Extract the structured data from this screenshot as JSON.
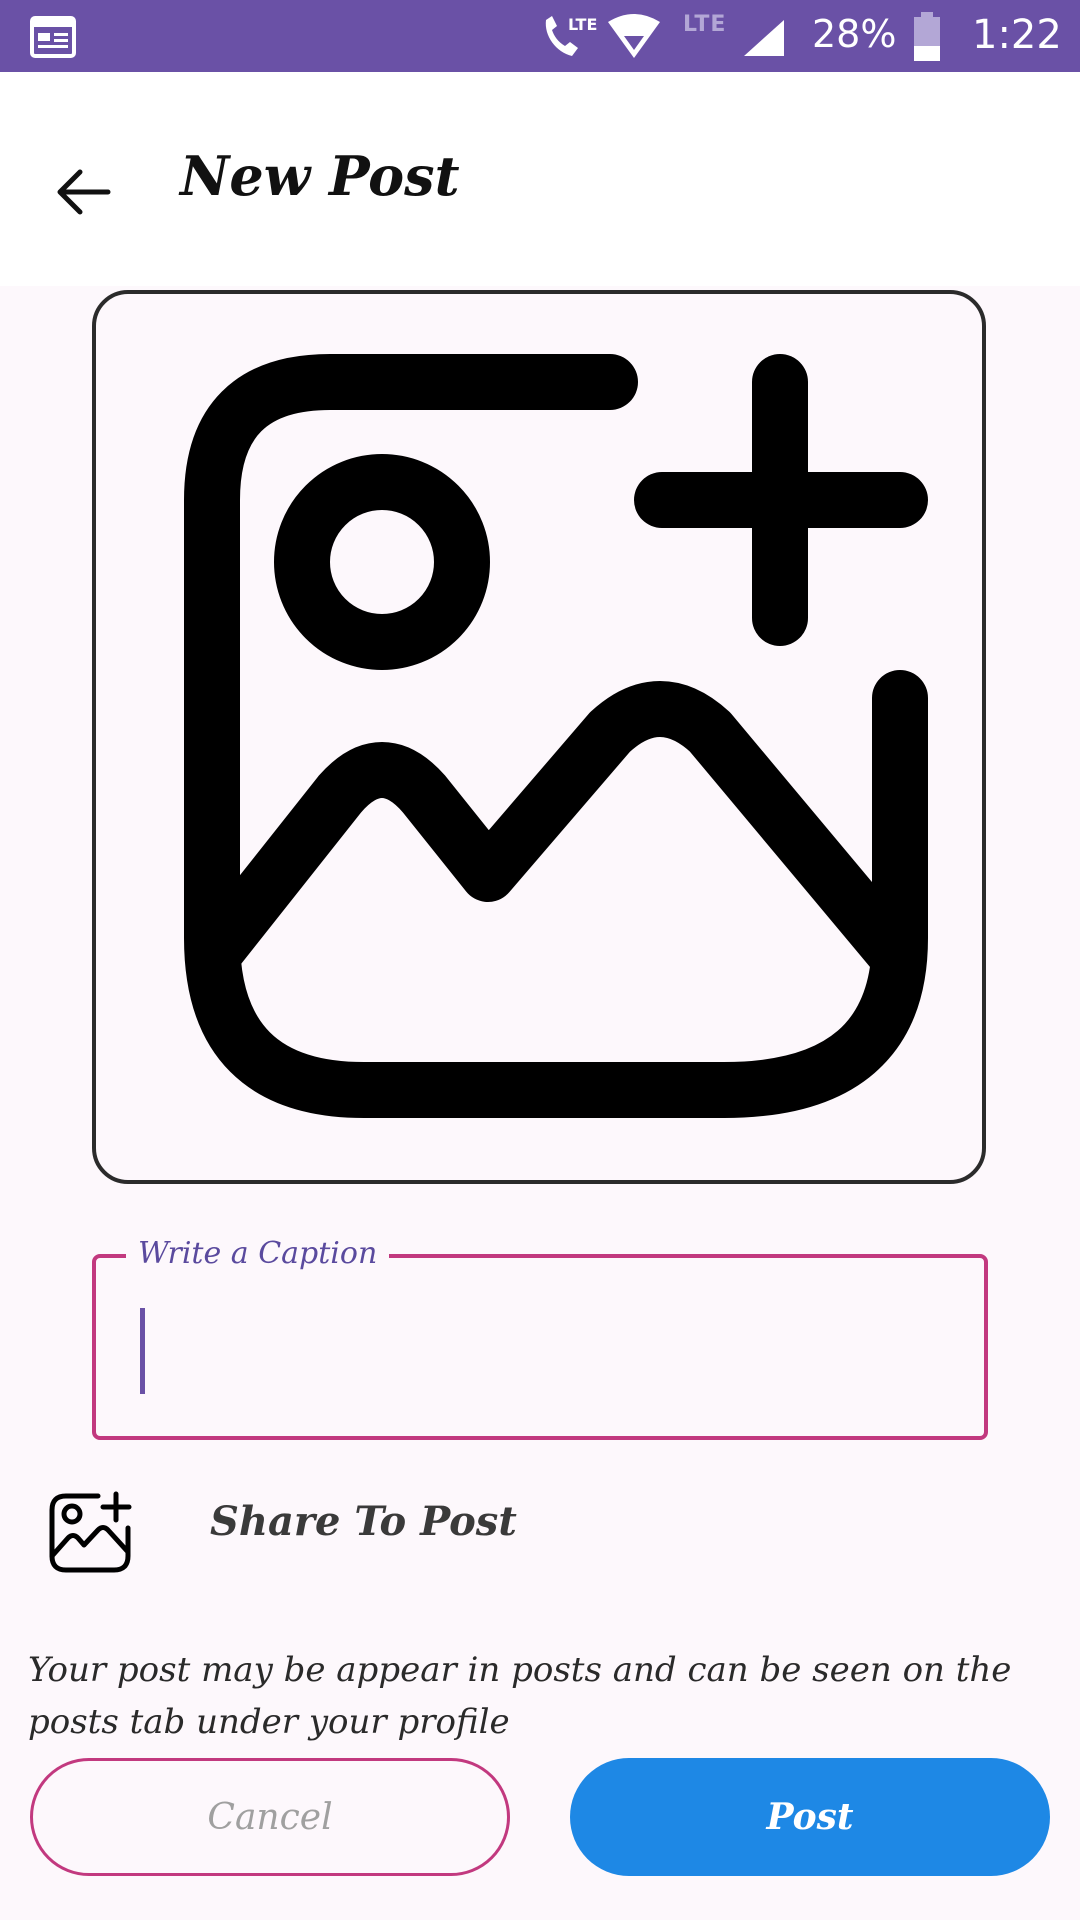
{
  "status_bar": {
    "lte_label": "LTE",
    "battery": "28%",
    "time": "1:22",
    "icons": [
      "calendar-icon",
      "volte-call-icon",
      "wifi-icon",
      "signal-icon",
      "battery-icon"
    ]
  },
  "app_bar": {
    "title": "New Post",
    "back_icon": "arrow-left-icon"
  },
  "image_picker": {
    "icon": "add-photo-icon"
  },
  "caption": {
    "label": "Write a Caption",
    "value": ""
  },
  "share": {
    "label": "Share To Post",
    "icon": "add-photo-icon"
  },
  "info_text": "Your post may be appear in posts and can be seen on the posts tab under your profile",
  "buttons": {
    "cancel": "Cancel",
    "post": "Post"
  },
  "colors": {
    "status_bar": "#6a51a6",
    "accent_pink": "#c2397f",
    "post_button": "#1e88e5",
    "background": "#fdf8fc"
  }
}
